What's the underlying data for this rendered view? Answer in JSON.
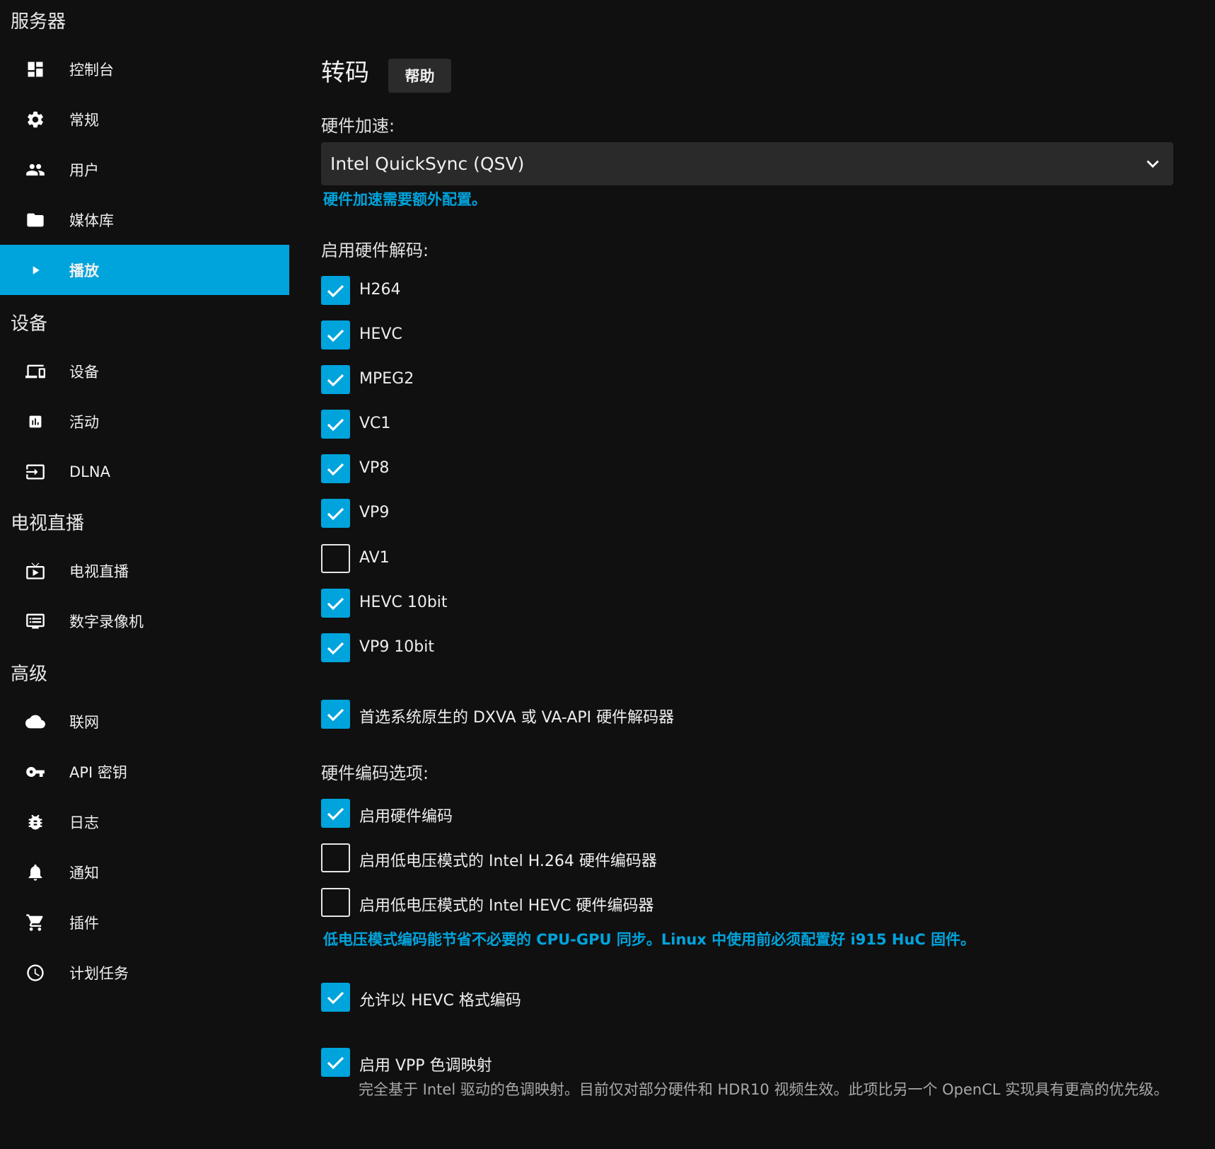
{
  "sidebar": {
    "sections": [
      {
        "title": "服务器",
        "items": [
          {
            "label": "控制台",
            "icon": "dashboard-icon"
          },
          {
            "label": "常规",
            "icon": "gear-icon"
          },
          {
            "label": "用户",
            "icon": "users-icon"
          },
          {
            "label": "媒体库",
            "icon": "folder-icon"
          },
          {
            "label": "播放",
            "icon": "play-icon",
            "active": true
          }
        ]
      },
      {
        "title": "设备",
        "items": [
          {
            "label": "设备",
            "icon": "devices-icon"
          },
          {
            "label": "活动",
            "icon": "activity-icon"
          },
          {
            "label": "DLNA",
            "icon": "input-icon"
          }
        ]
      },
      {
        "title": "电视直播",
        "items": [
          {
            "label": "电视直播",
            "icon": "live-tv-icon"
          },
          {
            "label": "数字录像机",
            "icon": "dvr-icon"
          }
        ]
      },
      {
        "title": "高级",
        "items": [
          {
            "label": "联网",
            "icon": "cloud-icon"
          },
          {
            "label": "API 密钥",
            "icon": "key-icon"
          },
          {
            "label": "日志",
            "icon": "bug-icon"
          },
          {
            "label": "通知",
            "icon": "bell-icon"
          },
          {
            "label": "插件",
            "icon": "cart-icon"
          },
          {
            "label": "计划任务",
            "icon": "clock-icon"
          }
        ]
      }
    ]
  },
  "main": {
    "title": "转码",
    "help_label": "帮助",
    "hw_accel_label": "硬件加速:",
    "hw_accel_value": "Intel QuickSync (QSV)",
    "hw_accel_link": "硬件加速需要额外配置。",
    "decode_label": "启用硬件解码:",
    "decoders": [
      {
        "label": "H264",
        "checked": true
      },
      {
        "label": "HEVC",
        "checked": true
      },
      {
        "label": "MPEG2",
        "checked": true
      },
      {
        "label": "VC1",
        "checked": true
      },
      {
        "label": "VP8",
        "checked": true
      },
      {
        "label": "VP9",
        "checked": true
      },
      {
        "label": "AV1",
        "checked": false
      },
      {
        "label": "HEVC 10bit",
        "checked": true
      },
      {
        "label": "VP9 10bit",
        "checked": true
      }
    ],
    "prefer_native": {
      "label": "首选系统原生的 DXVA 或 VA-API 硬件解码器",
      "checked": true
    },
    "encode_label": "硬件编码选项:",
    "encoders": [
      {
        "label": "启用硬件编码",
        "checked": true
      },
      {
        "label": "启用低电压模式的 Intel H.264 硬件编码器",
        "checked": false
      },
      {
        "label": "启用低电压模式的 Intel HEVC 硬件编码器",
        "checked": false
      }
    ],
    "low_power_link": "低电压模式编码能节省不必要的 CPU-GPU 同步。Linux 中使用前必须配置好 i915 HuC 固件。",
    "allow_hevc": {
      "label": "允许以 HEVC 格式编码",
      "checked": true
    },
    "vpp_tonemap": {
      "label": "启用 VPP 色调映射",
      "checked": true
    },
    "vpp_desc": "完全基于 Intel 驱动的色调映射。目前仅对部分硬件和 HDR10 视频生效。此项比另一个 OpenCL 实现具有更高的优先级。"
  },
  "colors": {
    "accent": "#00a4dc",
    "background": "#101010",
    "control": "#2a2a2a"
  }
}
